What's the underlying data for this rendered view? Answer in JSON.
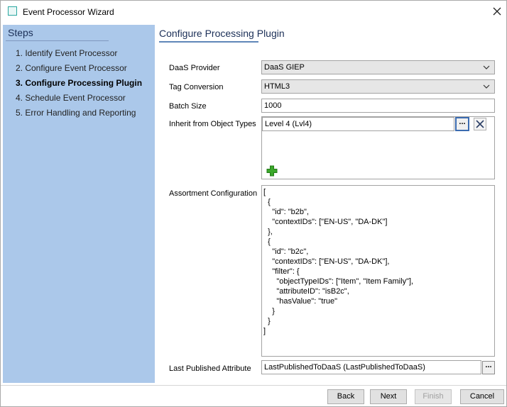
{
  "window": {
    "title": "Event Processor Wizard",
    "close_icon": "close-icon"
  },
  "sidebar": {
    "heading": "Steps",
    "steps": [
      {
        "label": "1. Identify Event Processor",
        "active": false
      },
      {
        "label": "2. Configure Event Processor",
        "active": false
      },
      {
        "label": "3. Configure Processing Plugin",
        "active": true
      },
      {
        "label": "4. Schedule Event Processor",
        "active": false
      },
      {
        "label": "5. Error Handling and Reporting",
        "active": false
      }
    ]
  },
  "main": {
    "heading": "Configure Processing Plugin",
    "daas_provider": {
      "label": "DaaS Provider",
      "value": "DaaS GIEP"
    },
    "tag_conversion": {
      "label": "Tag Conversion",
      "value": "HTML3"
    },
    "batch_size": {
      "label": "Batch Size",
      "value": "1000"
    },
    "inherit_types": {
      "label": "Inherit from Object Types",
      "value": "Level 4 (Lvl4)",
      "browse_label": "...",
      "add_icon": "plus-icon",
      "remove_icon": "remove-icon"
    },
    "assortment": {
      "label": "Assortment Configuration",
      "lines": [
        "[",
        "  {",
        "    \"id\": \"b2b\",",
        "    \"contextIDs\": [\"EN-US\", \"DA-DK\"]",
        "  },",
        "  {",
        "    \"id\": \"b2c\",",
        "    \"contextIDs\": [\"EN-US\", \"DA-DK\"],",
        "    \"filter\": {",
        "      \"objectTypeIDs\": [\"Item\", \"Item Family\"],",
        "      \"attributeID\": \"isB2c\",",
        "      \"hasValue\": \"true\"",
        "    }",
        "  }",
        "]"
      ]
    },
    "last_published": {
      "label": "Last Published Attribute",
      "value": "LastPublishedToDaaS (LastPublishedToDaaS)",
      "browse_label": "..."
    }
  },
  "footer": {
    "back": "Back",
    "next": "Next",
    "finish": "Finish",
    "cancel": "Cancel"
  },
  "colors": {
    "sidebar_bg": "#abc8ea",
    "heading_text": "#1b2f57",
    "accent_underline": "#5f86b8",
    "add_icon_green": "#3aa82a"
  }
}
